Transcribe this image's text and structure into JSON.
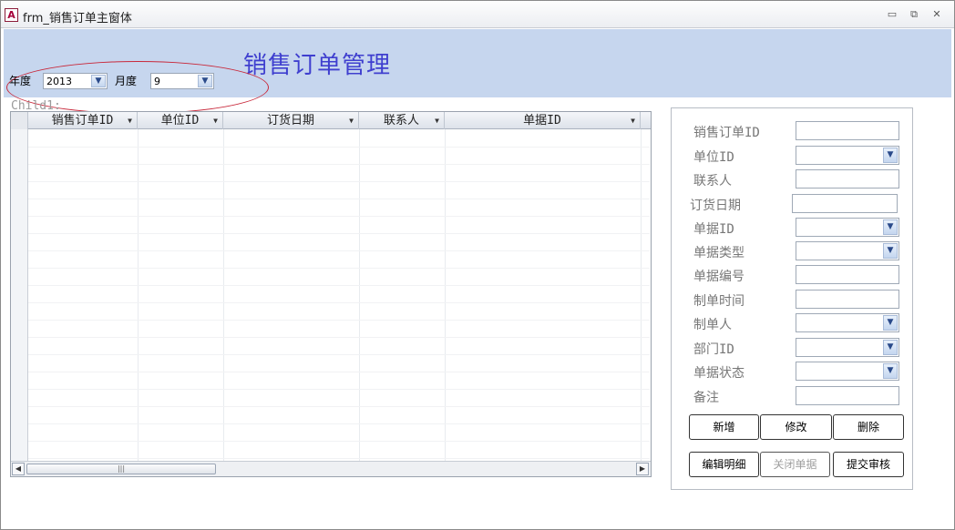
{
  "window": {
    "title": "frm_销售订单主窗体",
    "app_icon": "A",
    "minimize": "▭",
    "restore": "⧉",
    "close": "✕"
  },
  "header": {
    "title": "销售订单管理",
    "band_color": "#c6d6ee"
  },
  "filters": {
    "year_label": "年度",
    "year_value": "2013",
    "month_label": "月度",
    "month_value": "9"
  },
  "subform": {
    "label": "Child1:",
    "columns": [
      "销售订单ID",
      "单位ID",
      "订货日期",
      "联系人",
      "单据ID"
    ]
  },
  "detail": {
    "fields": [
      {
        "label": "销售订单ID",
        "type": "text"
      },
      {
        "label": "单位ID",
        "type": "combo"
      },
      {
        "label": "联系人",
        "type": "text"
      },
      {
        "label": "订货日期",
        "type": "text"
      },
      {
        "label": "单据ID",
        "type": "combo"
      },
      {
        "label": "单据类型",
        "type": "combo"
      },
      {
        "label": "单据编号",
        "type": "text"
      },
      {
        "label": "制单时间",
        "type": "text"
      },
      {
        "label": "制单人",
        "type": "combo"
      },
      {
        "label": "部门ID",
        "type": "combo"
      },
      {
        "label": "单据状态",
        "type": "combo"
      },
      {
        "label": "备注",
        "type": "text"
      }
    ],
    "buttons": {
      "add": "新增",
      "edit": "修改",
      "delete": "删除",
      "edit_detail": "编辑明细",
      "close_doc": "关闭单据",
      "submit_review": "提交审核"
    }
  },
  "colors": {
    "title_text": "#3f3fcf",
    "highlight_ellipse": "#c8283a"
  }
}
